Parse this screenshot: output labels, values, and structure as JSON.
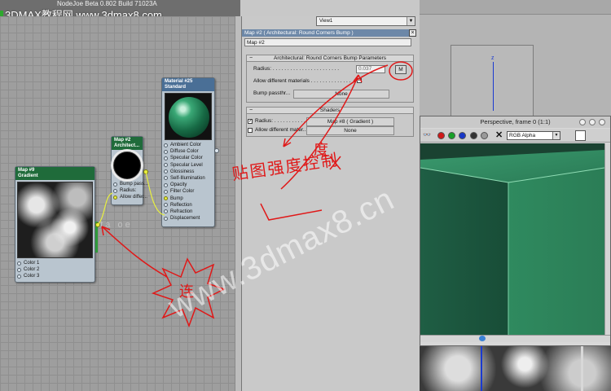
{
  "window": {
    "app_title": "NodeJoe Beta 0.802 Build 71023A",
    "watermark_top": "3DMAX教程网 www.3dmax8.com",
    "watermark_center": "www.3dmax8.cn"
  },
  "canvas": {
    "gradient_node": {
      "title_line1": "Map #9",
      "title_line2": "Gradient",
      "slots": [
        "Color 1",
        "Color 2",
        "Color 3"
      ]
    },
    "rcb_node": {
      "title_line1": "Map #2",
      "title_line2": "Architect...",
      "slots": [
        "Bump pass...",
        "Radius:",
        "Allow differ..."
      ]
    },
    "material_node": {
      "title_line1": "Material #25",
      "title_line2": "Standard",
      "slots": [
        "Ambient Color",
        "Diffuse Color",
        "Specular Color",
        "Specular Level",
        "Glossiness",
        "Self-Illumination",
        "Opacity",
        "Filter Color",
        "Bump",
        "Reflection",
        "Refraction",
        "Displacement"
      ]
    },
    "logo_text": "beta oe"
  },
  "panel": {
    "view_select": "View1",
    "title": "Map #2  ( Architectural: Round Corners Bump )",
    "map_name": "Map #2",
    "params_rollout": {
      "sign": "−",
      "title": "Architectural: Round Corners Bump Parameters",
      "radius_label": "Radius: . . . . . . . . . . . . . . . . . . . . . . .",
      "radius_value": "0.037",
      "m_button": "M",
      "allow_label": "Allow different materials . . . . . . . . . . . . . .",
      "allow_checked": "✓",
      "bump_label": "Bump passthr...",
      "bump_value": "None"
    },
    "shaders_rollout": {
      "sign": "−",
      "title": "Shaders",
      "radius_label": "Radius: . . . . . . . . . . . . . . . . .",
      "radius_map": "Map #8  ( Gradient )",
      "radius_checked": "✓",
      "allow_label": "Allow different mater...",
      "allow_value": "None"
    }
  },
  "viewport": {
    "title": "Perspective, frame 0 (1:1)",
    "channel": "RGB Alpha",
    "axis_label": "z"
  },
  "annotations": {
    "note_bracket_text": "贴图强度控制",
    "note_connect": "连",
    "note_degree": "度"
  },
  "colors": {
    "node_title_green": "#1f6b3a",
    "node_title_blue": "#4a6f96",
    "panel_title": "#6d88a8",
    "annotation_red": "#e01818",
    "render_green": "#2e7a57"
  }
}
